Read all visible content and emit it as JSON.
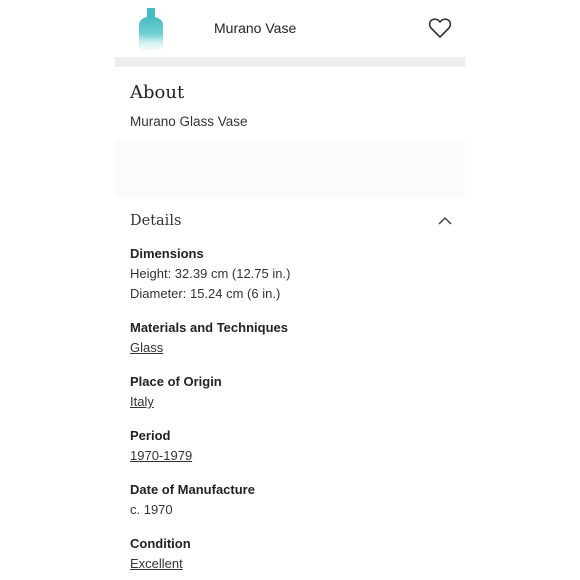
{
  "header": {
    "title": "Murano Vase",
    "thumbnail_icon": "vase-thumbnail-icon",
    "favorite_icon": "heart-icon"
  },
  "about": {
    "heading": "About",
    "text": "Murano Glass Vase"
  },
  "details": {
    "heading": "Details",
    "toggle_icon": "chevron-up-icon",
    "dimensions": {
      "label": "Dimensions",
      "height": "Height: 32.39 cm (12.75 in.)",
      "diameter": "Diameter: 15.24 cm (6 in.)"
    },
    "materials": {
      "label": "Materials and Techniques",
      "value": "Glass"
    },
    "origin": {
      "label": "Place of Origin",
      "value": "Italy"
    },
    "period": {
      "label": "Period",
      "value": "1970-1979"
    },
    "manufacture": {
      "label": "Date of Manufacture",
      "value": "c. 1970"
    },
    "condition": {
      "label": "Condition",
      "value": "Excellent"
    }
  },
  "colors": {
    "vase_teal": "#4fc3c6",
    "separator_gray": "#eeeeee",
    "text": "#222222"
  }
}
